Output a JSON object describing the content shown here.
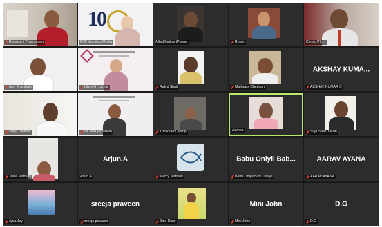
{
  "colors": {
    "tile_bg": "#2c2c2c",
    "grid_bg": "#1a1a1a",
    "active_border": "#b6e86a",
    "muted_icon": "#e0453a"
  },
  "participants": [
    {
      "label": "Ranjarani  Thampuran",
      "muted": true
    },
    {
      "label": "FCF Jecolutu Media",
      "muted": false
    },
    {
      "label": "Athul Baiju's iPhone",
      "muted": false
    },
    {
      "label": "Robin",
      "muted": true
    },
    {
      "label": "Cyriac Ph ...",
      "muted": false
    },
    {
      "label": "Ann Erambath",
      "muted": true
    },
    {
      "label": "Life with Lamia",
      "muted": true
    },
    {
      "label": "Rakhi Shaji",
      "muted": true
    },
    {
      "label": "Mathews Cheriyan",
      "muted": true
    },
    {
      "label": "AKSHAY KUMAR S",
      "muted": true,
      "overlay": "AKSHAY KUMA..."
    },
    {
      "label": "Sinju Thomas",
      "muted": true
    },
    {
      "label": "Dr. Anu Elizabeth",
      "muted": true
    },
    {
      "label": "Thinkpad Laptop",
      "muted": true
    },
    {
      "label": "Aamna",
      "muted": false
    },
    {
      "label": "Suja Shaji Jacob",
      "muted": true
    },
    {
      "label": "Jolce Mathew",
      "muted": true
    },
    {
      "label": "Arjun.A",
      "muted": false,
      "overlay": "Arjun.A"
    },
    {
      "label": "Mercy Mathew",
      "muted": true
    },
    {
      "label": "Babu Oniyil Babu Oniyil",
      "muted": true,
      "overlay": "Babu Oniyil Bab..."
    },
    {
      "label": "AARAV AYANA",
      "muted": true,
      "overlay": "AARAV AYANA"
    },
    {
      "label": "Ajna Joy",
      "muted": true
    },
    {
      "label": "sreeja praveen",
      "muted": true,
      "overlay": "sreeja praveen"
    },
    {
      "label": "Sinu Daisi",
      "muted": true
    },
    {
      "label": "Mini John",
      "muted": true,
      "overlay": "Mini John"
    },
    {
      "label": "D.G",
      "muted": true,
      "overlay": "D.G"
    }
  ]
}
